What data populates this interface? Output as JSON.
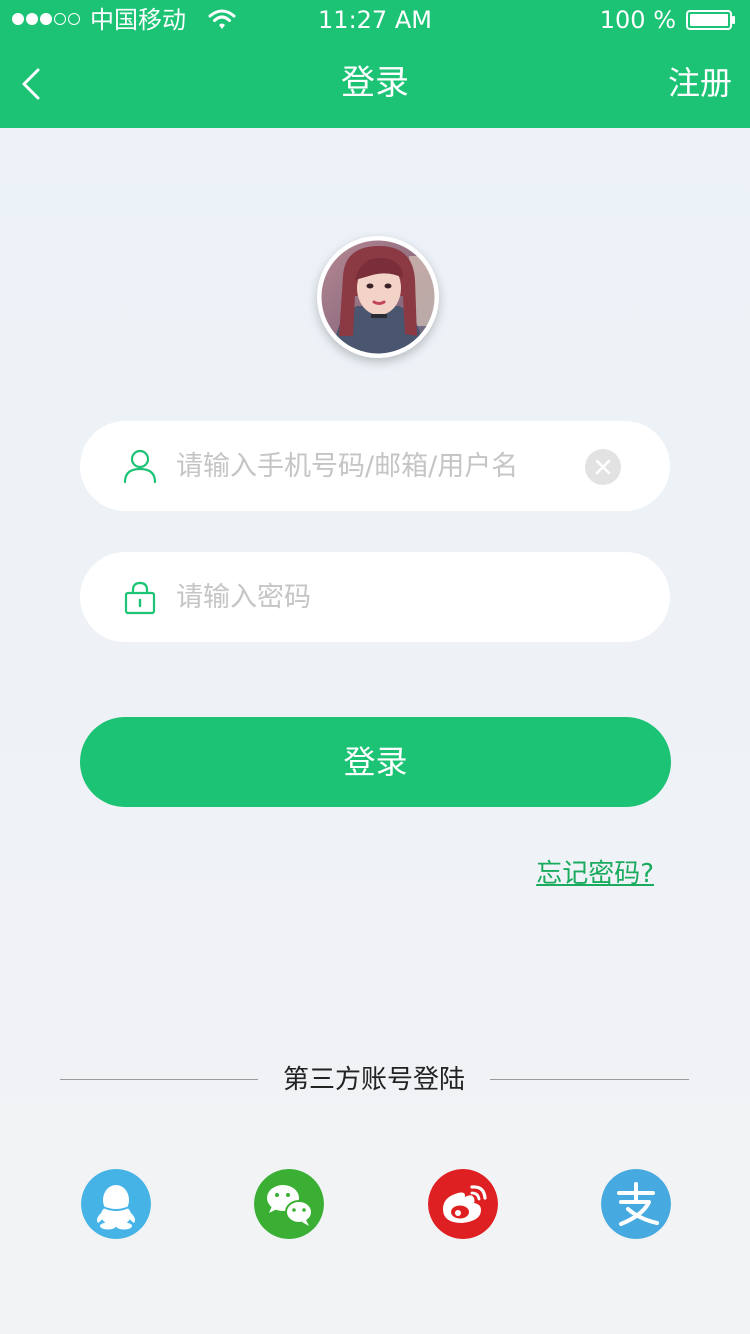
{
  "status_bar": {
    "carrier": "中国移动",
    "time": "11:27 AM",
    "battery_percent": "100 %",
    "signal_bars_filled": 3,
    "signal_bars_total": 5
  },
  "nav": {
    "title": "登录",
    "register_label": "注册"
  },
  "form": {
    "username_placeholder": "请输入手机号码/邮箱/用户名",
    "password_placeholder": "请输入密码",
    "login_label": "登录",
    "forgot_label": "忘记密码?"
  },
  "third_party": {
    "title": "第三方账号登陆",
    "providers": [
      {
        "icon": "qq-icon",
        "color": "#45b3e6"
      },
      {
        "icon": "wechat-icon",
        "color": "#3aaf34"
      },
      {
        "icon": "weibo-icon",
        "color": "#de2022"
      },
      {
        "icon": "alipay-icon",
        "color": "#46aae0"
      }
    ]
  },
  "theme": {
    "primary": "#1cc374",
    "link": "#1aab5f"
  }
}
